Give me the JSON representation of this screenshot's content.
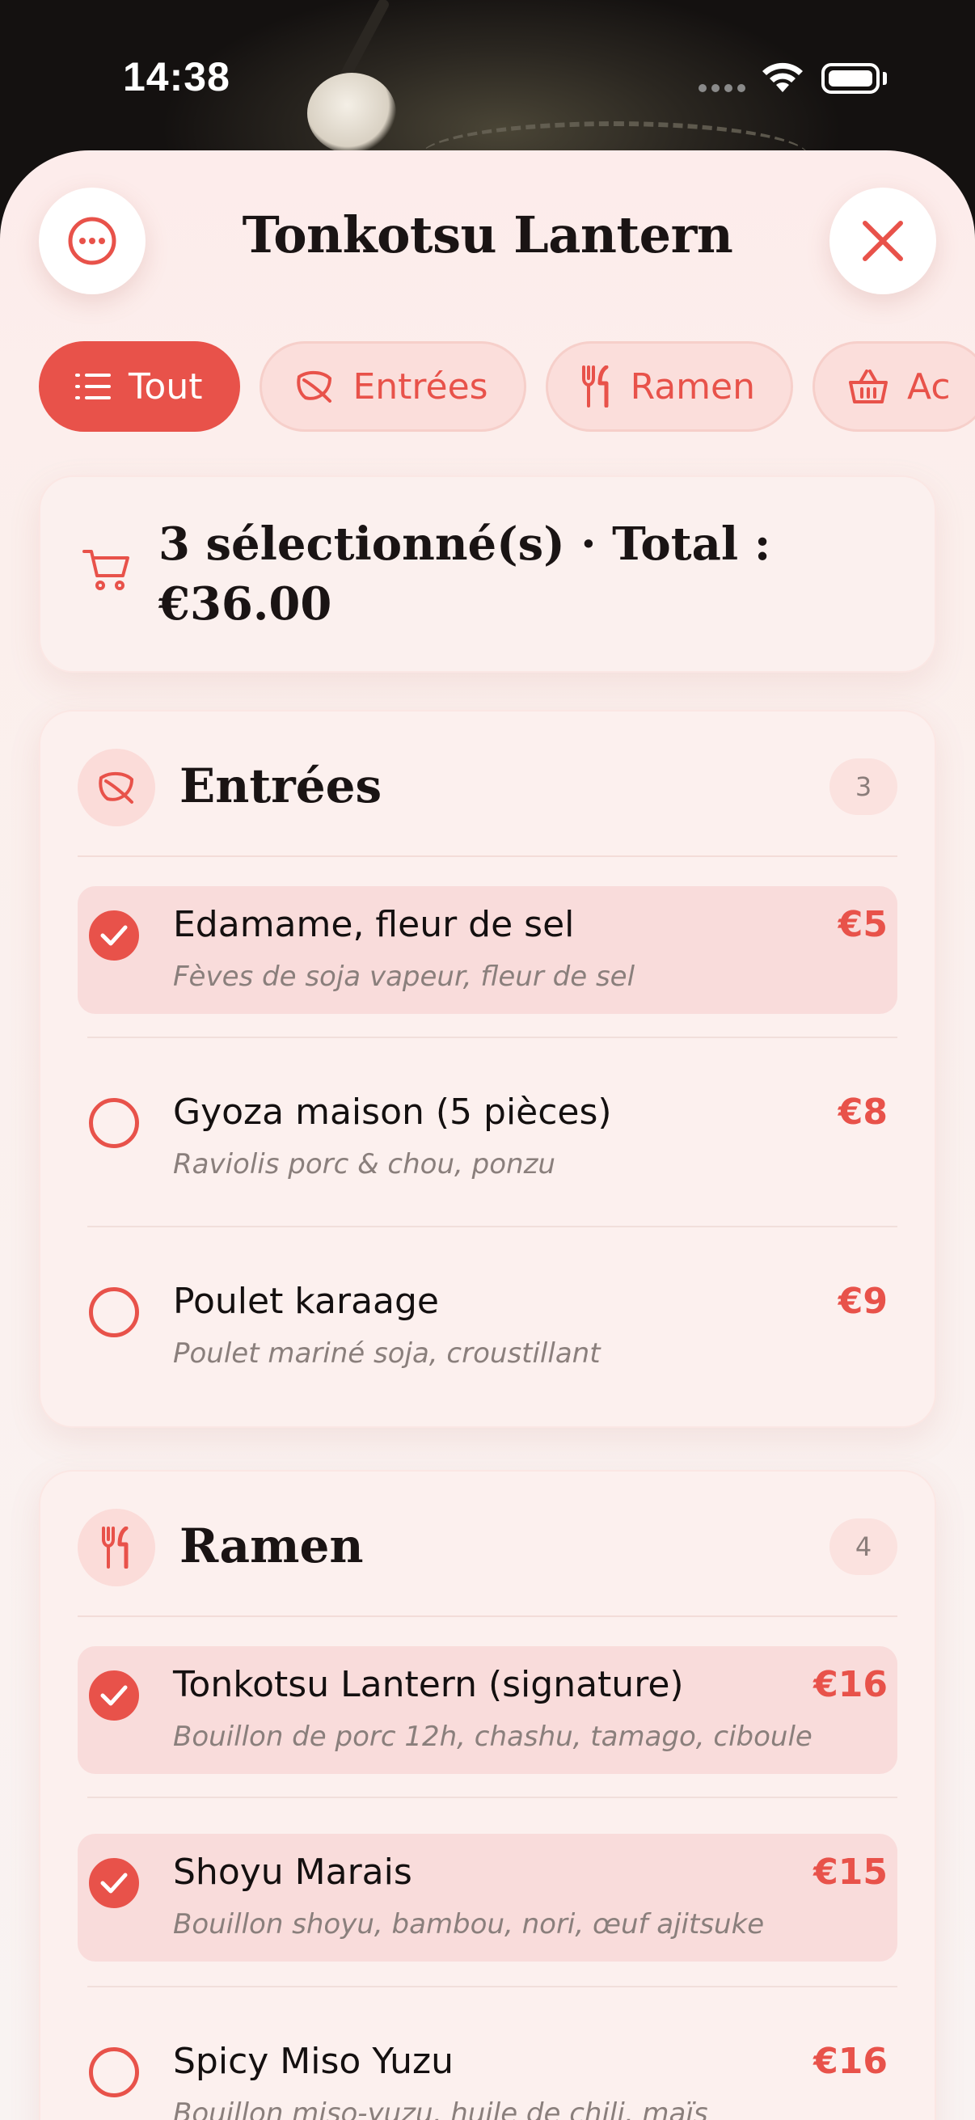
{
  "status_bar": {
    "time": "14:38"
  },
  "header": {
    "title": "Tonkotsu Lantern",
    "more_icon": "ellipsis-icon",
    "close_icon": "close-icon"
  },
  "chips": [
    {
      "label": "Tout",
      "icon": "list-icon",
      "active": true
    },
    {
      "label": "Entrées",
      "icon": "leaf-icon",
      "active": false
    },
    {
      "label": "Ramen",
      "icon": "fork-knife-icon",
      "active": false
    },
    {
      "label": "Ac",
      "icon": "basket-icon",
      "active": false
    }
  ],
  "summary": {
    "icon": "cart-icon",
    "text": "3 sélectionné(s) · Total : €36.00"
  },
  "sections": [
    {
      "title": "Entrées",
      "count": "3",
      "icon": "leaf-icon",
      "items": [
        {
          "name": "Edamame, fleur de sel",
          "desc": "Fèves de soja vapeur, fleur de sel",
          "price": "€5",
          "selected": true
        },
        {
          "name": "Gyoza maison (5 pièces)",
          "desc": "Raviolis porc & chou, ponzu",
          "price": "€8",
          "selected": false
        },
        {
          "name": "Poulet karaage",
          "desc": "Poulet mariné soja, croustillant",
          "price": "€9",
          "selected": false
        }
      ]
    },
    {
      "title": "Ramen",
      "count": "4",
      "icon": "fork-knife-icon",
      "items": [
        {
          "name": "Tonkotsu Lantern (signature)",
          "desc": "Bouillon de porc 12h, chashu, tamago, ciboule",
          "price": "€16",
          "selected": true
        },
        {
          "name": "Shoyu Marais",
          "desc": "Bouillon shoyu, bambou, nori, œuf ajitsuke",
          "price": "€15",
          "selected": true
        },
        {
          "name": "Spicy Miso Yuzu",
          "desc": "Bouillon miso-yuzu, huile de chili, maïs",
          "price": "€16",
          "selected": false
        }
      ]
    }
  ],
  "colors": {
    "accent": "#e8524a",
    "sheet": "#fbefec",
    "selected_row": "#f9dcdb"
  }
}
